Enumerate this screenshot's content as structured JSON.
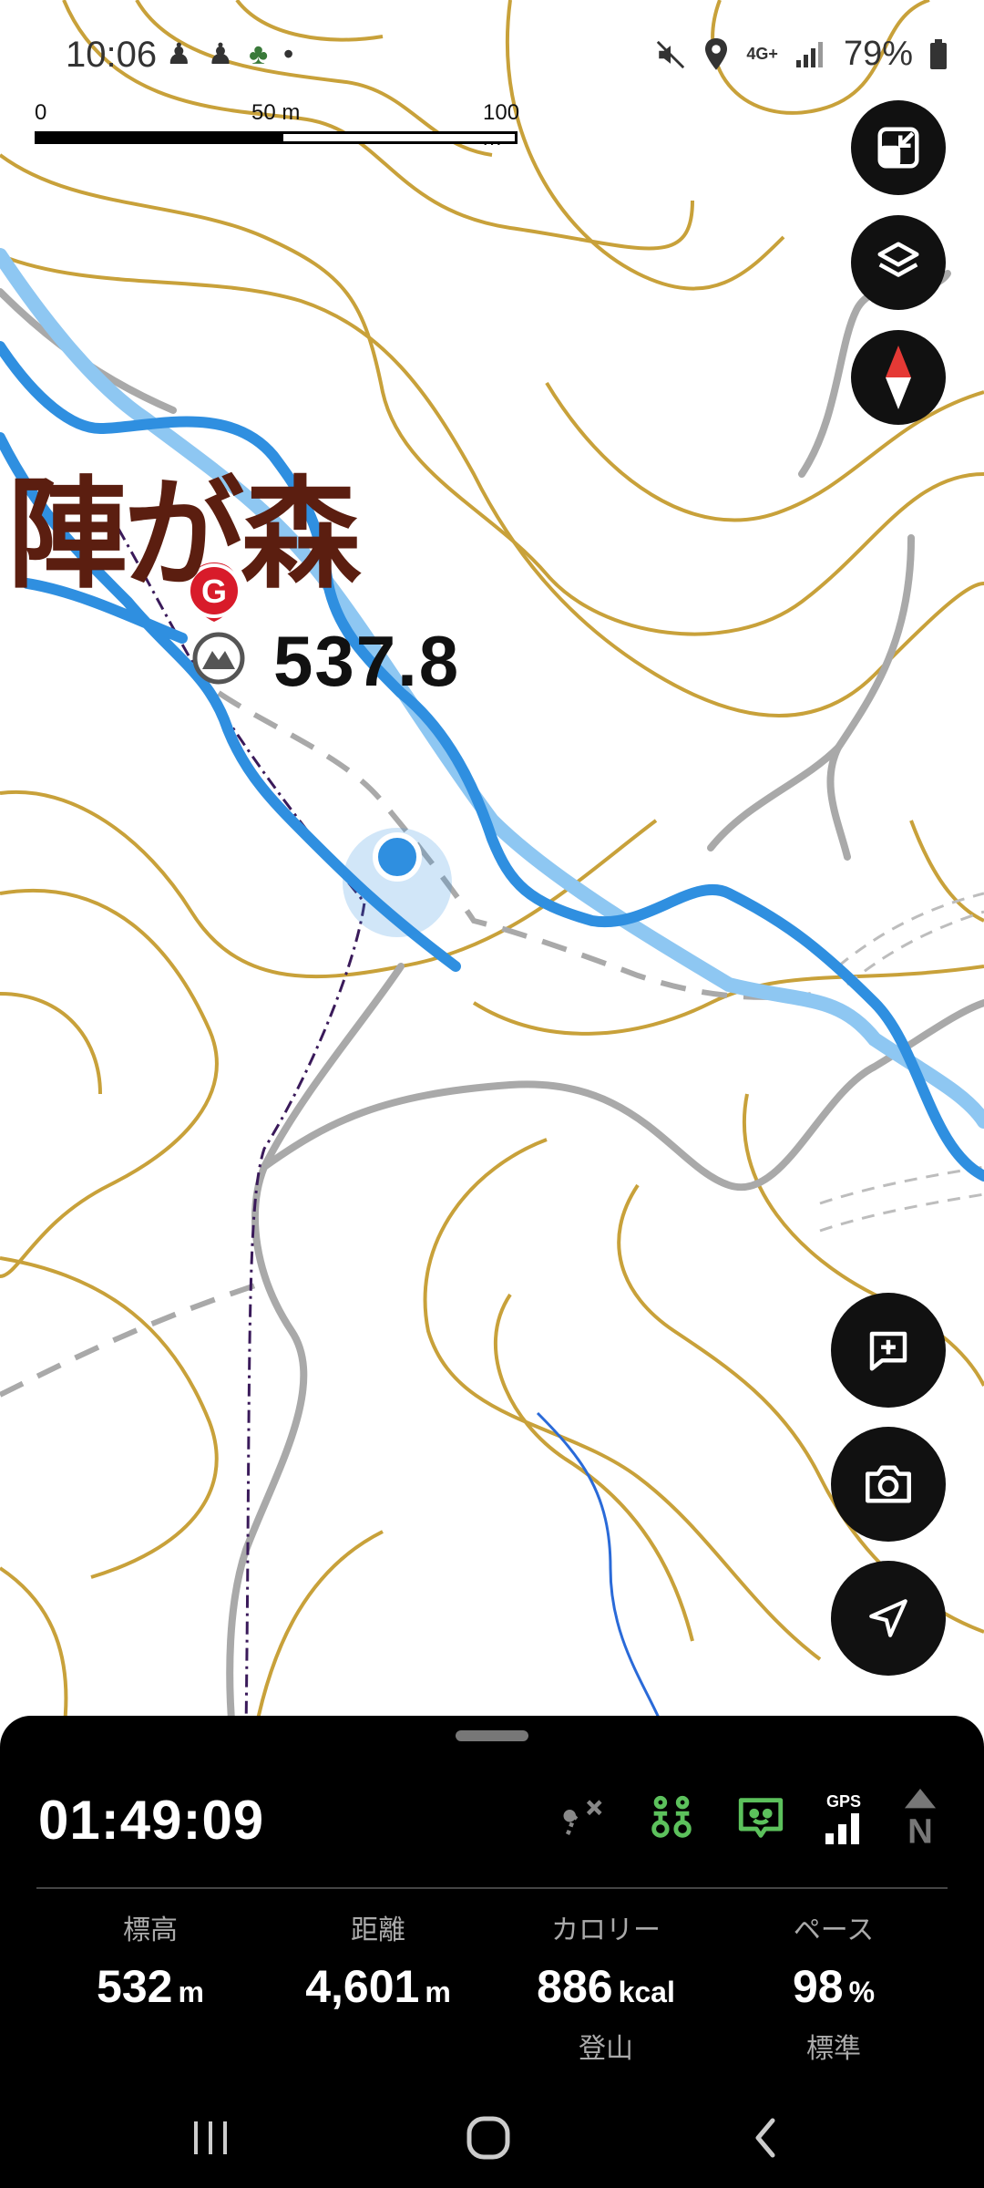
{
  "status_bar": {
    "time": "10:06",
    "notification_icons": [
      "hiker-icon",
      "hiker-icon",
      "tree-icon",
      "dot-icon"
    ],
    "network": "4G+",
    "battery": "79%"
  },
  "scale_bar": {
    "labels": [
      "0",
      "50 m",
      "100 m"
    ]
  },
  "map": {
    "place_name": "陣が森",
    "peak_elevation": "537.8",
    "goal_marker": "G",
    "colors": {
      "contour": "#c8a13a",
      "track": "#2f8fe0",
      "track_light": "#8ec7f2",
      "road": "#a9a9a9",
      "path": "#3a1a5a",
      "stream": "#2a6ad8"
    }
  },
  "map_controls": {
    "buttons": [
      "fit-screen-icon",
      "layers-icon",
      "compass-icon"
    ],
    "actions": [
      "add-memo-icon",
      "camera-icon",
      "navigate-icon"
    ]
  },
  "tracking_panel": {
    "elapsed_time": "01:49:09",
    "status_icons": [
      "off-route-icon",
      "companions-icon",
      "safety-share-icon",
      "gps-signal-icon",
      "north-up-icon"
    ],
    "gps_label": "GPS",
    "stats": [
      {
        "label": "標高",
        "value": "532",
        "unit": "m",
        "sub": ""
      },
      {
        "label": "距離",
        "value": "4,601",
        "unit": "m",
        "sub": ""
      },
      {
        "label": "カロリー",
        "value": "886",
        "unit": "kcal",
        "sub": "登山"
      },
      {
        "label": "ペース",
        "value": "98",
        "unit": "%",
        "sub": "標準"
      }
    ]
  },
  "nav_bar": {
    "buttons": [
      "recents-icon",
      "home-icon",
      "back-icon"
    ]
  }
}
